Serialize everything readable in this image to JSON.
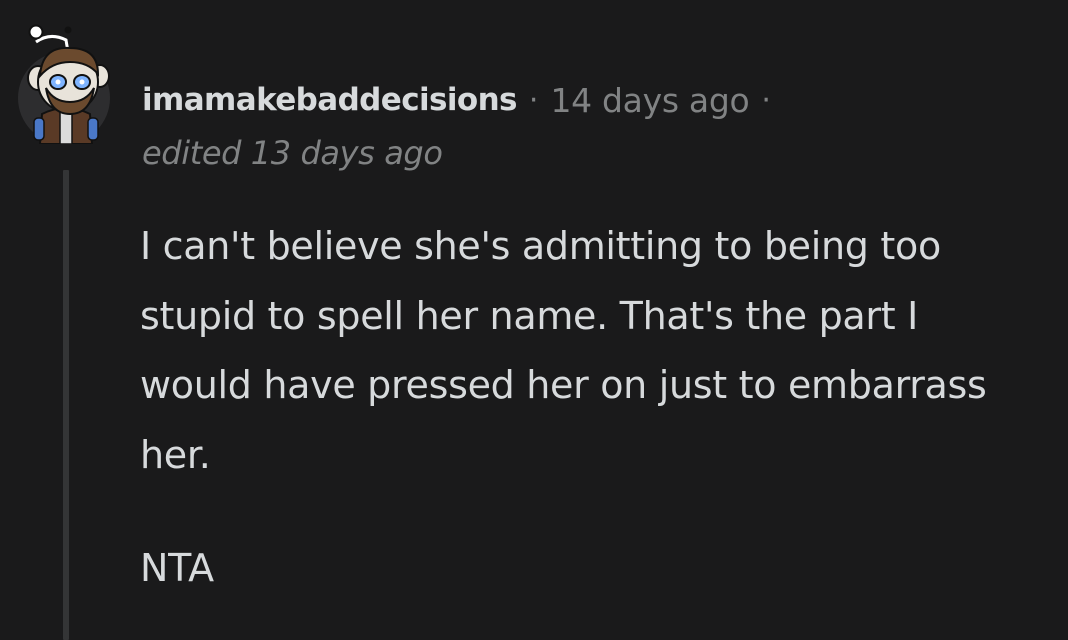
{
  "comment": {
    "username": "imamakebaddecisions",
    "separator": "·",
    "timestamp": "14 days ago",
    "edited": "edited 13 days ago",
    "paragraphs": [
      "I can't believe she's admitting to being too stupid to spell her name. That's the part I would have pressed her on just to embarrass her.",
      "NTA"
    ]
  },
  "avatar_icon": "snoo-avatar-icon",
  "colors": {
    "background": "#1a1a1b",
    "text": "#d7dadc",
    "muted": "#818384",
    "thread_line": "#343536"
  }
}
